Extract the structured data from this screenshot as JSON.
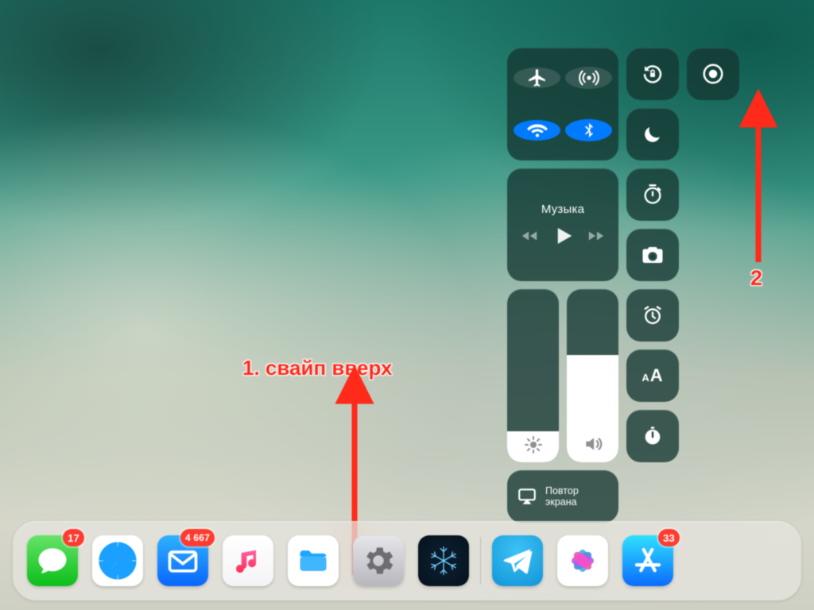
{
  "dock": {
    "apps_left": [
      {
        "name": "messages",
        "badge": "17"
      },
      {
        "name": "safari",
        "badge": null
      },
      {
        "name": "mail",
        "badge": "4 667"
      },
      {
        "name": "music",
        "badge": null
      },
      {
        "name": "files",
        "badge": null
      },
      {
        "name": "settings",
        "badge": null
      },
      {
        "name": "wallpaper",
        "badge": null
      }
    ],
    "apps_right": [
      {
        "name": "telegram",
        "badge": null
      },
      {
        "name": "photos",
        "badge": null
      },
      {
        "name": "appstore",
        "badge": "33"
      }
    ]
  },
  "control_center": {
    "music_label": "Музыка",
    "mirror_label": "Повтор\nэкрана",
    "brightness_fill_pct": 18,
    "volume_fill_pct": 62
  },
  "annotations": {
    "step1_text": "1. свайп вверх",
    "step2_text": "2"
  },
  "colors": {
    "accent_red": "#ff2a1a",
    "ios_blue": "#007aff"
  }
}
